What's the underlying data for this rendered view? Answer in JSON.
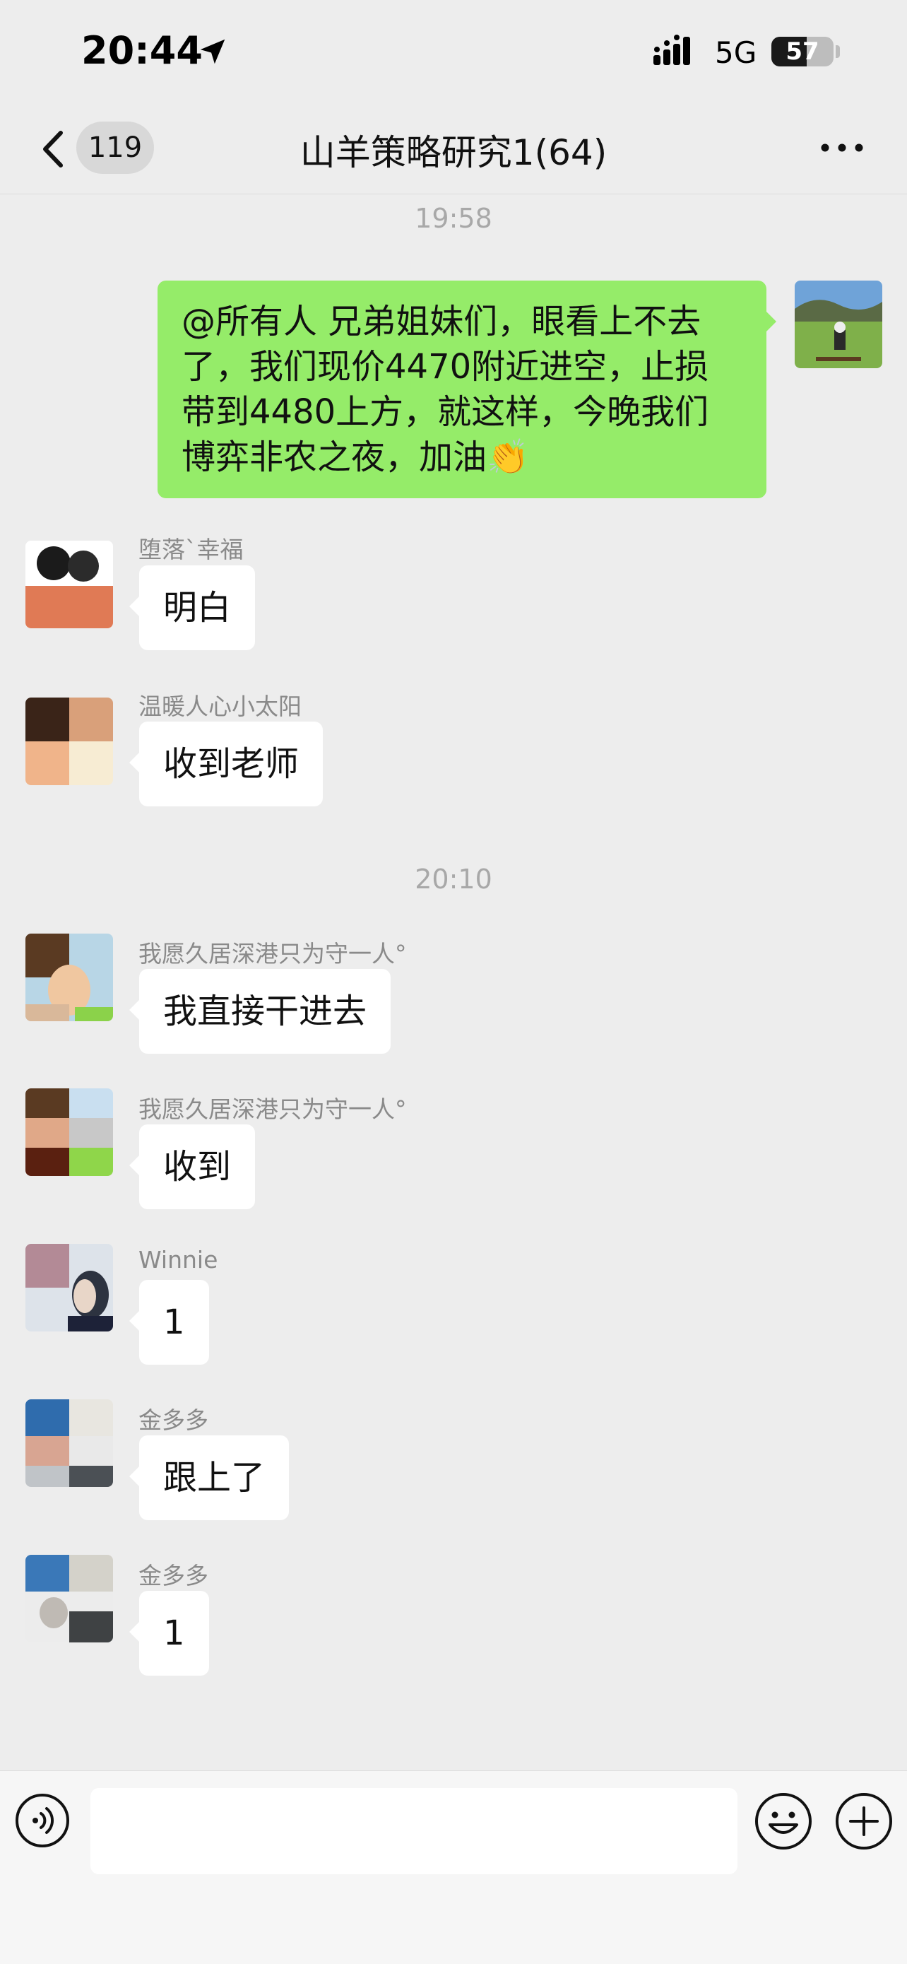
{
  "status_bar": {
    "time": "20:44",
    "network": "5G",
    "battery": "57",
    "battery_level": 0.57
  },
  "nav": {
    "back_count": "119",
    "title": "山羊策略研究1(64)"
  },
  "chat": {
    "timestamps": [
      "19:58",
      "20:10"
    ],
    "outgoing": {
      "text": "@所有人 兄弟姐妹们，眼看上不去了，我们现价4470附近进空，止损带到4480上方，就这样，今晚我们博弈非农之夜，加油👏"
    },
    "incoming": [
      {
        "sender": "堕落`幸福",
        "text": "明白"
      },
      {
        "sender": "温暖人心小太阳",
        "text": "收到老师"
      },
      {
        "sender": "我愿久居深港只为守一人°",
        "text": "我直接干进去"
      },
      {
        "sender": "我愿久居深港只为守一人°",
        "text": "收到"
      },
      {
        "sender": "Winnie",
        "text": "1"
      },
      {
        "sender": "金多多",
        "text": "跟上了"
      },
      {
        "sender": "金多多",
        "text": "1"
      }
    ]
  },
  "input_bar": {
    "message_value": ""
  },
  "icons": {
    "location": "location-arrow-icon",
    "signal": "signal-bars-icon",
    "back": "chevron-left-icon",
    "more": "more-dots-icon",
    "voice": "voice-icon",
    "emoji": "emoji-icon",
    "plus": "plus-icon"
  },
  "colors": {
    "outgoing_bubble": "#95ec69",
    "incoming_bubble": "#ffffff",
    "background": "#ededed"
  }
}
